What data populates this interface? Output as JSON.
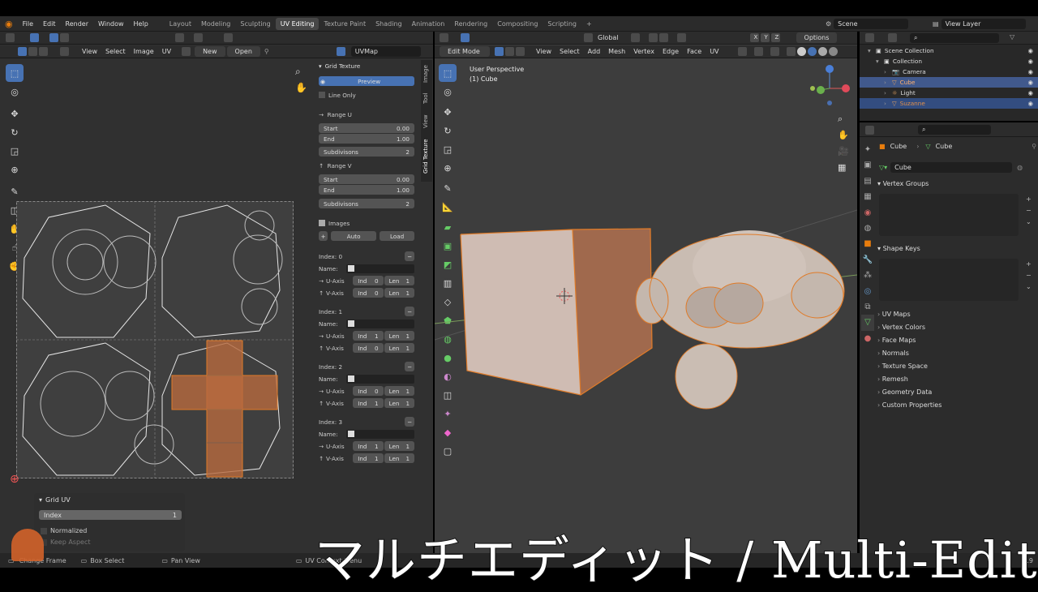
{
  "topbar": {
    "menus": [
      "File",
      "Edit",
      "Render",
      "Window",
      "Help"
    ],
    "workspaces": [
      "Layout",
      "Modeling",
      "Sculpting",
      "UV Editing",
      "Texture Paint",
      "Shading",
      "Animation",
      "Rendering",
      "Compositing",
      "Scripting"
    ],
    "active_workspace": "UV Editing",
    "scene": "Scene",
    "view_layer": "View Layer"
  },
  "uv_editor": {
    "menus": [
      "View",
      "Select",
      "Image",
      "UV"
    ],
    "new_label": "New",
    "open_label": "Open",
    "uvmap": "UVMap"
  },
  "grid_panel": {
    "title": "Grid Texture",
    "preview": "Preview",
    "line_only": "Line Only",
    "range_u": "Range U",
    "range_v": "Range V",
    "start_label": "Start",
    "end_label": "End",
    "start": "0.00",
    "end": "1.00",
    "subdiv_label": "Subdivisons",
    "subdiv": "2",
    "images": "Images",
    "auto": "Auto",
    "load": "Load",
    "name_label": "Name:",
    "u_axis": "U-Axis",
    "v_axis": "V-Axis",
    "ind": "Ind",
    "len": "Len",
    "indices": [
      {
        "label": "Index: 0",
        "u_ind": "0",
        "u_len": "1",
        "v_ind": "0",
        "v_len": "1"
      },
      {
        "label": "Index: 1",
        "u_ind": "1",
        "u_len": "1",
        "v_ind": "0",
        "v_len": "1"
      },
      {
        "label": "Index: 2",
        "u_ind": "0",
        "u_len": "1",
        "v_ind": "1",
        "v_len": "1"
      },
      {
        "label": "Index: 3",
        "u_ind": "1",
        "u_len": "1",
        "v_ind": "1",
        "v_len": "1"
      }
    ],
    "tabs": [
      "Image",
      "Tool",
      "View",
      "Grid Texture"
    ]
  },
  "grid_uv": {
    "title": "Grid UV",
    "index_label": "Index",
    "index_value": "1",
    "normalized": "Normalized",
    "keep_aspect": "Keep Aspect"
  },
  "viewport": {
    "mode": "Edit Mode",
    "orientation": "Global",
    "menus": [
      "View",
      "Select",
      "Add",
      "Mesh",
      "Vertex",
      "Edge",
      "Face",
      "UV"
    ],
    "options": "Options",
    "perspective": "User Perspective",
    "object": "(1) Cube",
    "axes": [
      "X",
      "Y",
      "Z"
    ]
  },
  "outliner": {
    "items": [
      {
        "label": "Scene Collection",
        "indent": 0
      },
      {
        "label": "Collection",
        "indent": 1
      },
      {
        "label": "Camera",
        "indent": 2
      },
      {
        "label": "Cube",
        "indent": 2
      },
      {
        "label": "Light",
        "indent": 2
      },
      {
        "label": "Suzanne",
        "indent": 2
      }
    ]
  },
  "properties": {
    "object": "Cube",
    "mesh": "Cube",
    "mesh_field": "Cube",
    "vertex_groups": "Vertex Groups",
    "shape_keys": "Shape Keys",
    "sections": [
      "UV Maps",
      "Vertex Colors",
      "Face Maps",
      "Normals",
      "Texture Space",
      "Remesh",
      "Geometry Data",
      "Custom Properties"
    ]
  },
  "statusbar": {
    "items": [
      "Change Frame",
      "Box Select",
      "Pan View",
      "UV Context Menu"
    ],
    "version": "2.9"
  },
  "caption": "マルチエディット / Multi-Edit",
  "colors": {
    "accent": "#4772b3",
    "selection_orange": "#e07b28",
    "header": "#2b2b2b"
  }
}
